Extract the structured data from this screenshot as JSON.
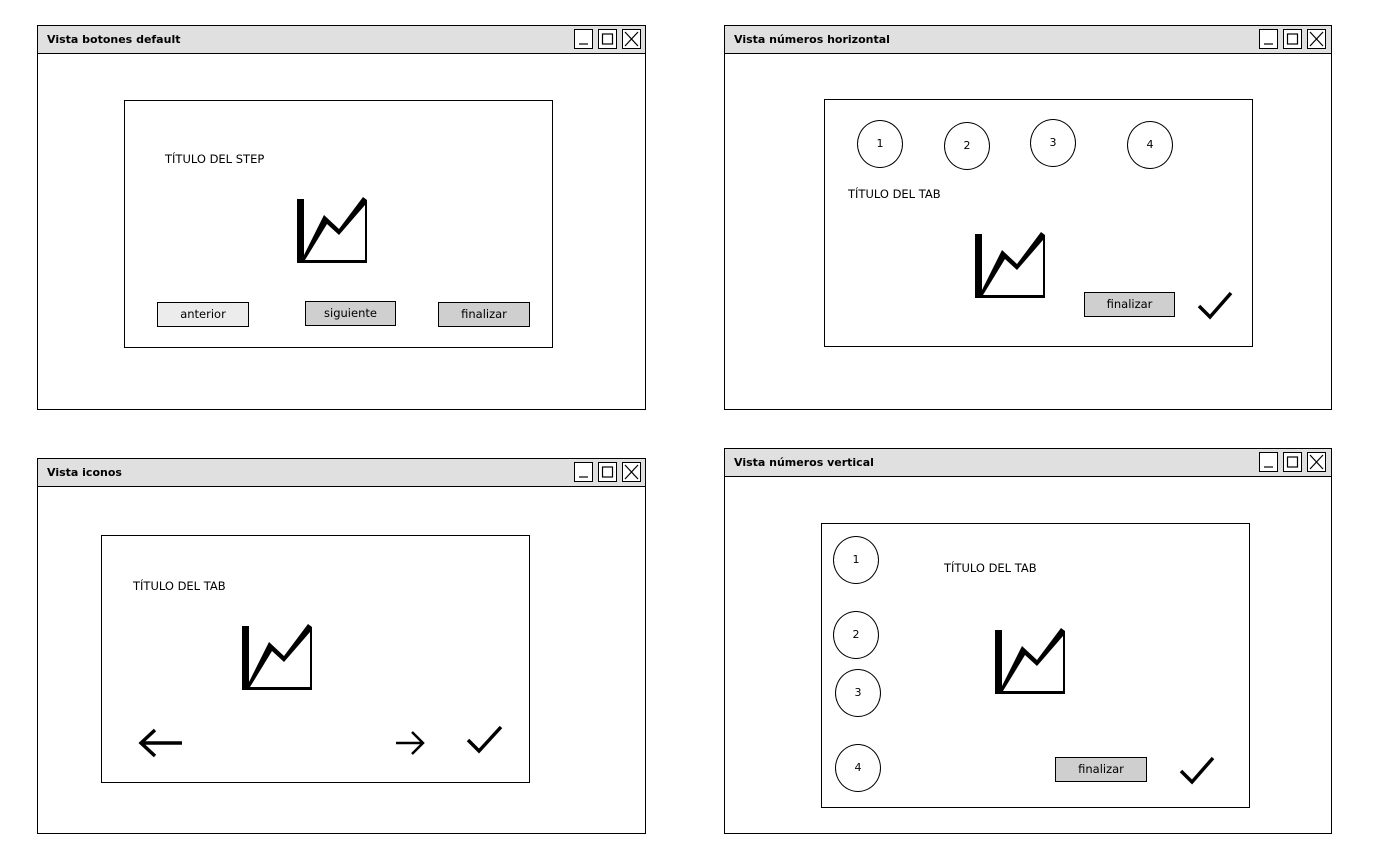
{
  "windows": [
    {
      "title": "Vista botones default",
      "step_title": "TÍTULO DEL STEP",
      "buttons": [
        "anterior",
        "siguiente",
        "finalizar"
      ]
    },
    {
      "title": "Vista números horizontal",
      "steps": [
        "1",
        "2",
        "3",
        "4"
      ],
      "tab_title": "TÍTULO DEL TAB",
      "finish_label": "finalizar"
    },
    {
      "title": "Vista iconos",
      "tab_title": "TÍTULO DEL TAB"
    },
    {
      "title": "Vista números vertical",
      "steps": [
        "1",
        "2",
        "3",
        "4"
      ],
      "tab_title": "TÍTULO DEL TAB",
      "finish_label": "finalizar"
    }
  ],
  "icons": {
    "chart": "area-chart-icon",
    "check": "checkmark-icon",
    "arrow_left": "arrow-left-icon",
    "arrow_right": "arrow-right-icon",
    "minimize": "minimize-icon",
    "maximize": "maximize-icon",
    "close": "close-icon"
  }
}
